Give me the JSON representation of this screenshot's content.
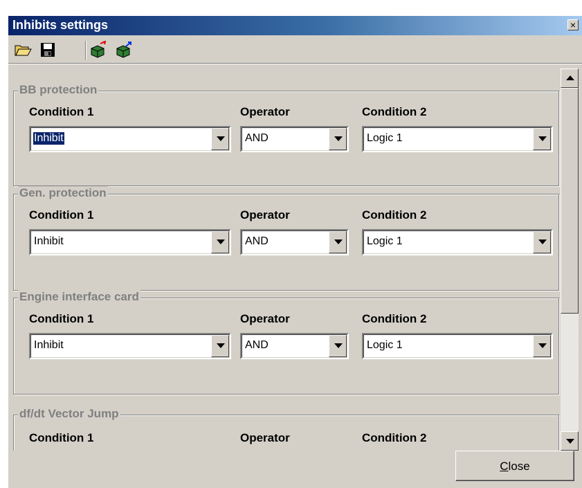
{
  "window": {
    "title": "Inhibits settings",
    "close_glyph": "×"
  },
  "toolbar": {
    "icons": [
      "open-folder-icon",
      "save-icon",
      "import-icon",
      "export-icon"
    ]
  },
  "groups": [
    {
      "title": "BB protection",
      "condition1_label": "Condition 1",
      "operator_label": "Operator",
      "condition2_label": "Condition 2",
      "condition1": "Inhibit",
      "operator": "AND",
      "condition2": "Logic 1"
    },
    {
      "title": "Gen. protection",
      "condition1_label": "Condition 1",
      "operator_label": "Operator",
      "condition2_label": "Condition 2",
      "condition1": "Inhibit",
      "operator": "AND",
      "condition2": "Logic 1"
    },
    {
      "title": "Engine interface card",
      "condition1_label": "Condition 1",
      "operator_label": "Operator",
      "condition2_label": "Condition 2",
      "condition1": "Inhibit",
      "operator": "AND",
      "condition2": "Logic 1"
    },
    {
      "title": "df/dt Vector Jump",
      "condition1_label": "Condition 1",
      "operator_label": "Operator",
      "condition2_label": "Condition 2"
    }
  ],
  "scrollbar": {
    "thumb_fraction": 0.66
  },
  "footer": {
    "close_mnemonic": "C",
    "close_rest": "lose"
  },
  "colors": {
    "title_start": "#0a246a",
    "title_end": "#a6caf0",
    "face": "#d4d0c8",
    "group_title": "#808080",
    "selection": "#0a246a"
  }
}
